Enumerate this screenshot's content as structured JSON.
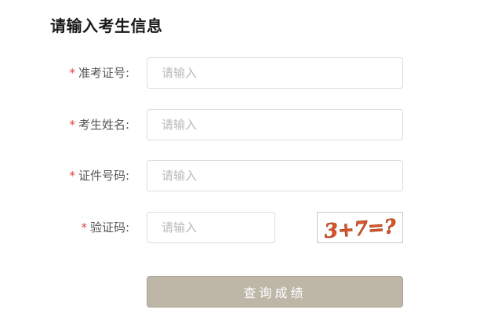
{
  "page": {
    "title": "请输入考生信息"
  },
  "form": {
    "required_mark": "*",
    "fields": [
      {
        "label": "准考证号:",
        "placeholder": "请输入",
        "value": ""
      },
      {
        "label": "考生姓名:",
        "placeholder": "请输入",
        "value": ""
      },
      {
        "label": "证件号码:",
        "placeholder": "请输入",
        "value": ""
      },
      {
        "label": "验证码:",
        "placeholder": "请输入",
        "value": ""
      }
    ],
    "captcha": {
      "text": "3+7=?",
      "color": "#e0542a"
    },
    "submit_label": "查询成绩",
    "colors": {
      "required": "#e0433a",
      "button_bg": "#beb6a6",
      "button_text": "#ffffff"
    }
  }
}
